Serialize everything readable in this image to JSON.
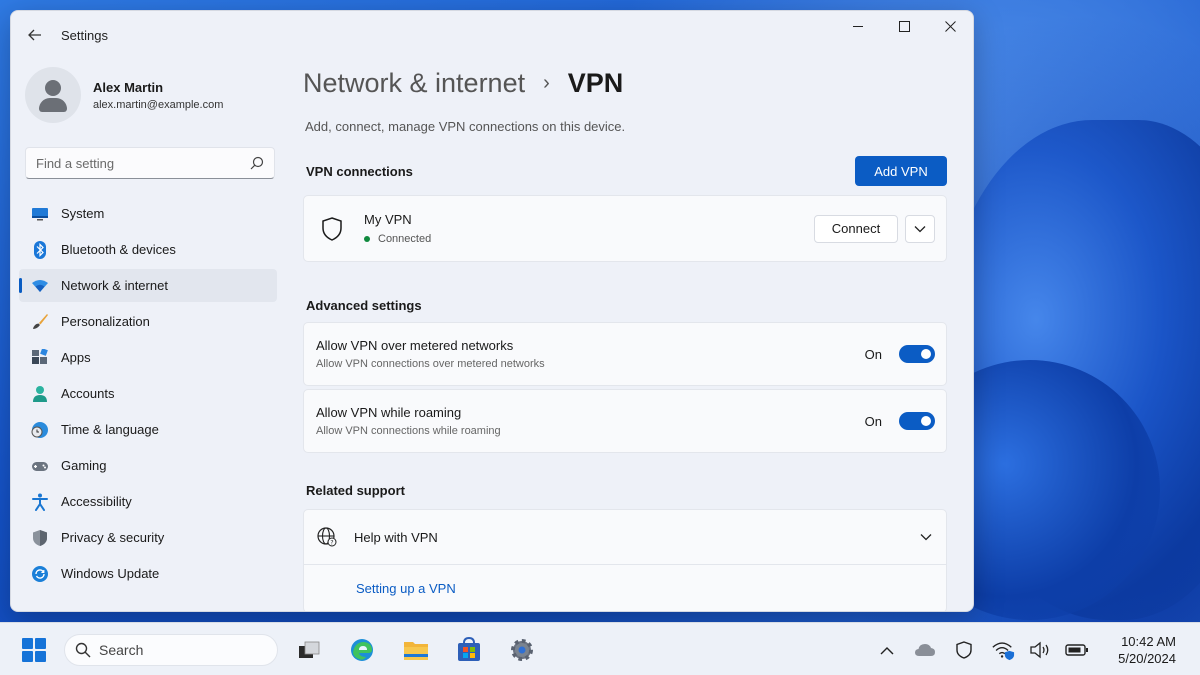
{
  "window": {
    "app_title": "Settings",
    "controls": {
      "minimize": "minimize",
      "maximize": "maximize",
      "close": "close"
    }
  },
  "profile": {
    "name": "Alex Martin",
    "email": "alex.martin@example.com"
  },
  "search": {
    "placeholder": "Find a setting"
  },
  "sidebar": {
    "items": [
      {
        "label": "System",
        "icon": "monitor-icon",
        "active": false
      },
      {
        "label": "Bluetooth & devices",
        "icon": "bluetooth-icon",
        "active": false
      },
      {
        "label": "Network & internet",
        "icon": "wifi-icon",
        "active": true
      },
      {
        "label": "Personalization",
        "icon": "brush-icon",
        "active": false
      },
      {
        "label": "Apps",
        "icon": "apps-icon",
        "active": false
      },
      {
        "label": "Accounts",
        "icon": "person-icon",
        "active": false
      },
      {
        "label": "Time & language",
        "icon": "globe-clock-icon",
        "active": false
      },
      {
        "label": "Gaming",
        "icon": "gamepad-icon",
        "active": false
      },
      {
        "label": "Accessibility",
        "icon": "accessibility-icon",
        "active": false
      },
      {
        "label": "Privacy & security",
        "icon": "shield-icon",
        "active": false
      },
      {
        "label": "Windows Update",
        "icon": "update-icon",
        "active": false
      }
    ]
  },
  "main": {
    "breadcrumb_parent": "Network & internet",
    "breadcrumb_sep": "›",
    "breadcrumb_current": "VPN",
    "subtitle": "Add, connect, manage VPN connections on this device.",
    "vpn_section_title": "VPN connections",
    "add_vpn_label": "Add VPN",
    "vpn": {
      "name": "My VPN",
      "status": "Connected",
      "connect_label": "Connect"
    },
    "advanced_title": "Advanced settings",
    "toggles": [
      {
        "title": "Allow VPN over metered networks",
        "description": "Allow VPN connections over metered networks",
        "state": "On"
      },
      {
        "title": "Allow VPN while roaming",
        "description": "Allow VPN connections while roaming",
        "state": "On"
      }
    ],
    "support_title": "Related support",
    "help_label": "Help with VPN",
    "help_link": "Setting up a VPN"
  },
  "taskbar": {
    "search_label": "Search",
    "apps": [
      "task-view-icon",
      "edge-icon",
      "file-explorer-icon",
      "store-icon",
      "settings-icon"
    ],
    "tray": [
      "chevron-up-icon",
      "onedrive-icon",
      "security-icon",
      "wifi-icon",
      "volume-icon",
      "battery-icon"
    ],
    "time": "10:42 AM",
    "date": "5/20/2024"
  },
  "colors": {
    "accent": "#0b5cc4",
    "status_connected": "#10893e"
  }
}
